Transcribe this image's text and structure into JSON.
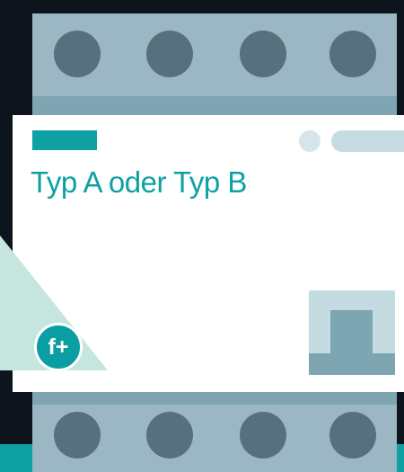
{
  "label": {
    "title": "Typ A oder Typ B"
  },
  "badge": {
    "text": "f+"
  },
  "colors": {
    "accent": "#0fa0a3",
    "device_body": "#9ab7c3",
    "terminal": "#56717d",
    "background": "#0d141d",
    "mint": "#c5e6de"
  }
}
